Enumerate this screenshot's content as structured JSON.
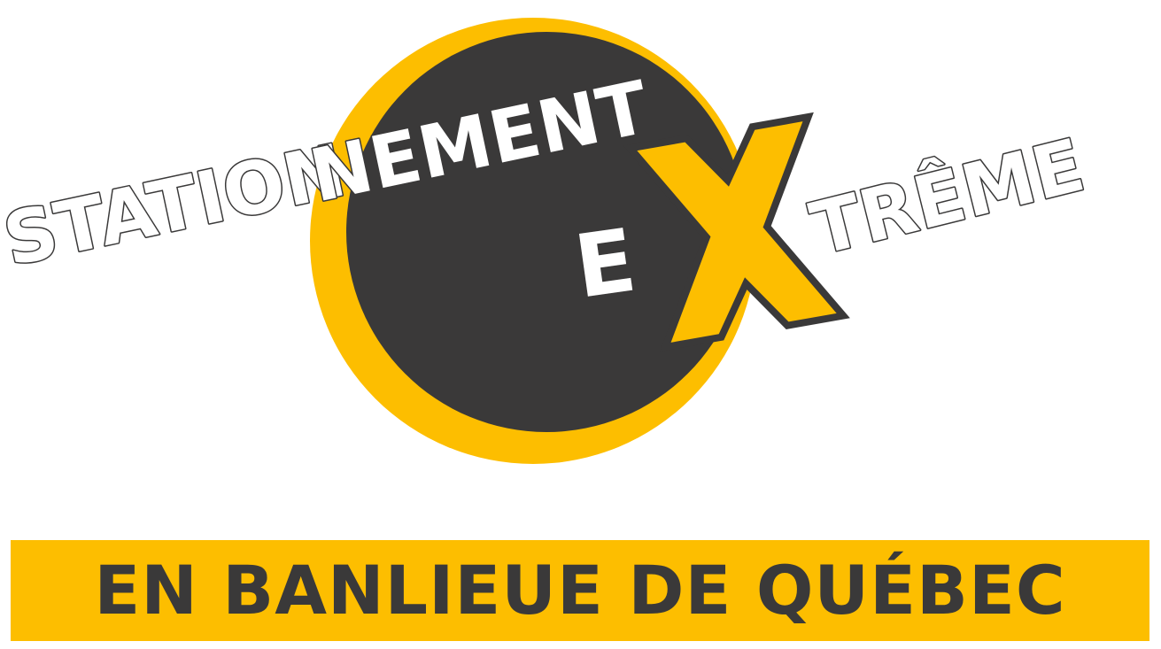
{
  "logo": {
    "word_station": "STATION",
    "word_nement": "NEMENT",
    "letter_e": "E",
    "letter_x": "X",
    "word_treme": "TRÊME"
  },
  "banner": {
    "text": "EN BANLIEUE DE QUÉBEC"
  },
  "colors": {
    "yellow": "#FDBE00",
    "dark": "#3A3939",
    "white": "#FFFFFF",
    "outline": "#3A3939"
  }
}
